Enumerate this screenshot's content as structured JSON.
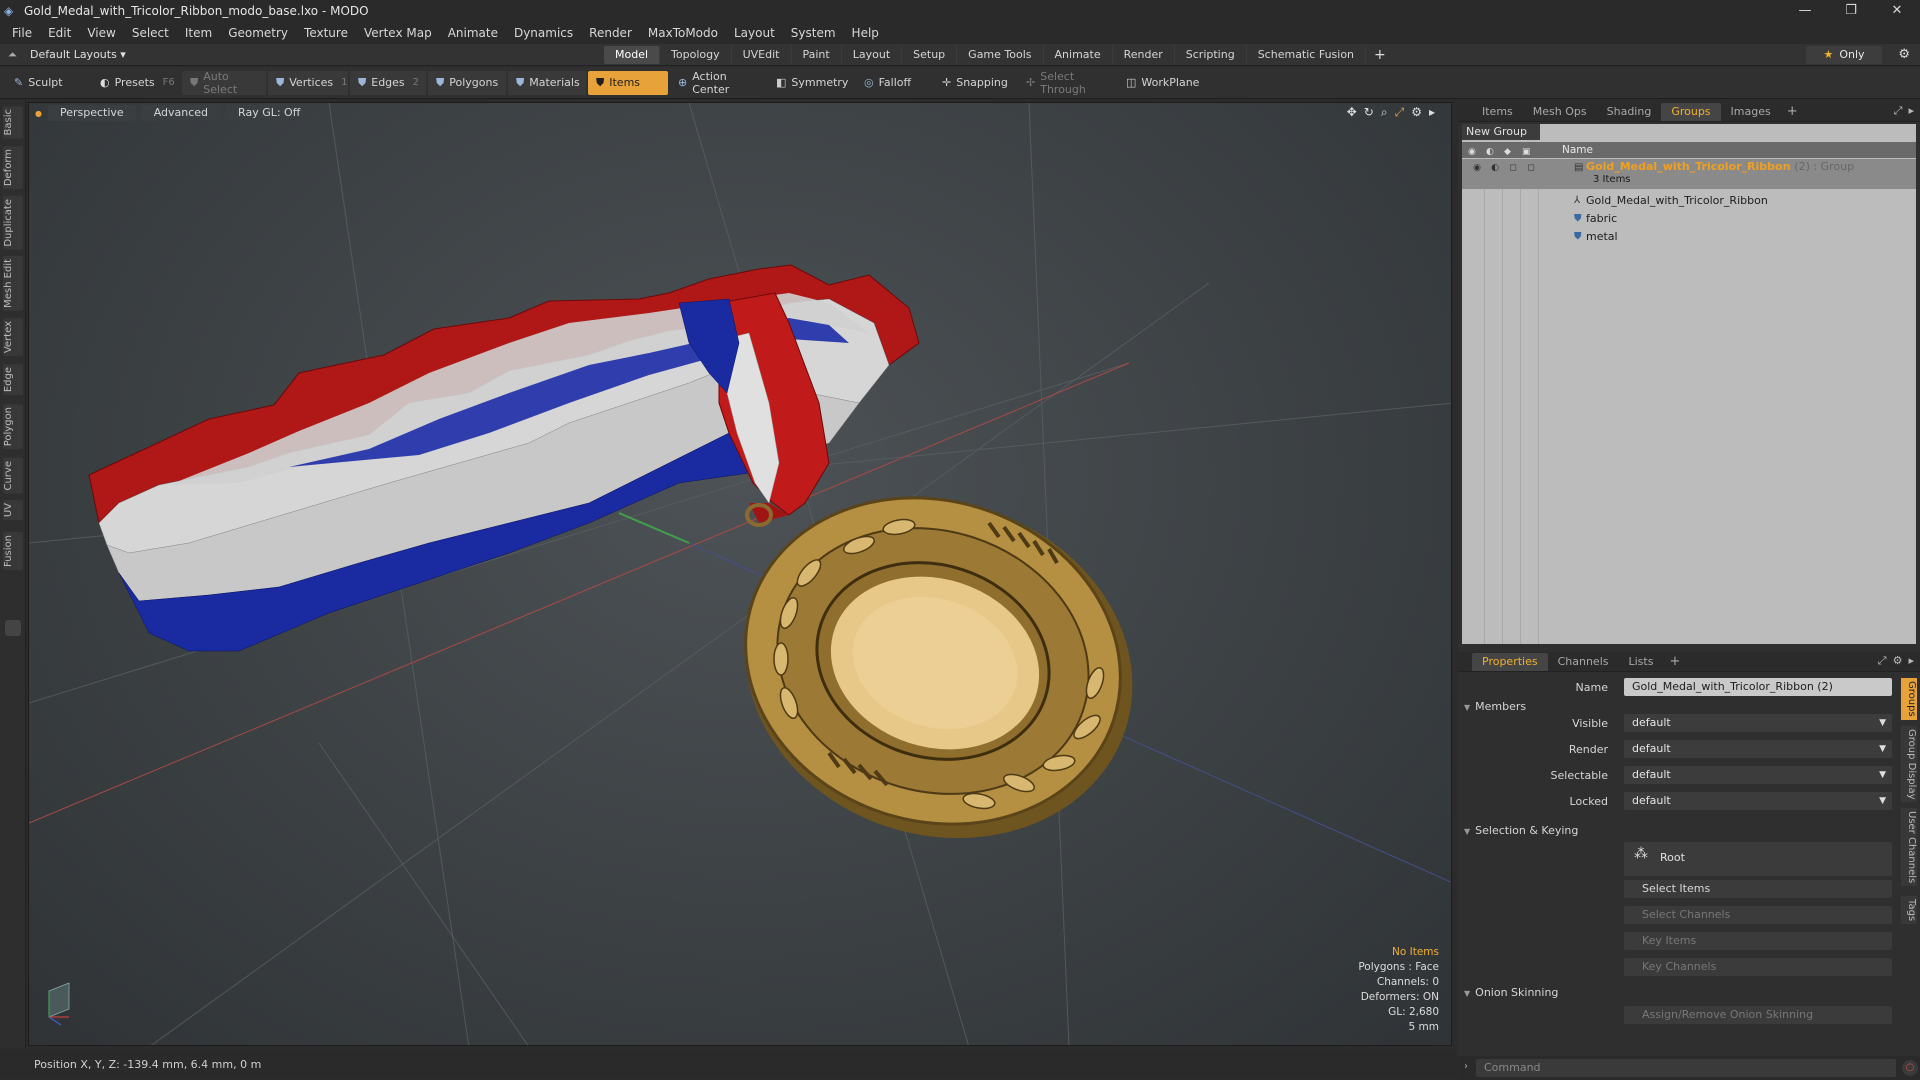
{
  "window": {
    "title": "Gold_Medal_with_Tricolor_Ribbon_modo_base.lxo - MODO",
    "minimize": "—",
    "restore": "❐",
    "close": "✕"
  },
  "menu": [
    "File",
    "Edit",
    "View",
    "Select",
    "Item",
    "Geometry",
    "Texture",
    "Vertex Map",
    "Animate",
    "Dynamics",
    "Render",
    "MaxToModo",
    "Layout",
    "System",
    "Help"
  ],
  "layoutbar": {
    "layouts_label": "Default Layouts ▾",
    "tabs": [
      "Model",
      "Topology",
      "UVEdit",
      "Paint",
      "Layout",
      "Setup",
      "Game Tools",
      "Animate",
      "Render",
      "Scripting",
      "Schematic Fusion"
    ],
    "active_tab": "Model",
    "add_tab": "+",
    "only_label": "Only"
  },
  "toolbar": {
    "sculpt": "Sculpt",
    "presets": "Presets",
    "presets_key": "F6",
    "auto_select": "Auto Select",
    "vertices": "Vertices",
    "vertices_count": "1",
    "edges": "Edges",
    "edges_count": "2",
    "polygons": "Polygons",
    "materials": "Materials",
    "items": "Items",
    "action_center": "Action Center",
    "symmetry": "Symmetry",
    "falloff": "Falloff",
    "snapping": "Snapping",
    "select_through": "Select Through",
    "workplane": "WorkPlane"
  },
  "left_tabs": [
    "Basic",
    "Deform",
    "Duplicate",
    "Mesh Edit",
    "Vertex",
    "Edge",
    "Polygon",
    "Curve",
    "UV",
    "Fusion"
  ],
  "viewport": {
    "view_mode": "Perspective",
    "shading": "Advanced",
    "raygl": "Ray GL: Off",
    "info": {
      "no_items": "No Items",
      "polygons": "Polygons : Face",
      "channels": "Channels: 0",
      "deformers": "Deformers: ON",
      "gl": "GL: 2,680",
      "scale": "5 mm"
    }
  },
  "status": {
    "position": "Position X, Y, Z:  -139.4 mm, 6.4 mm, 0 m"
  },
  "right_top_tabs": [
    "Items",
    "Mesh Ops",
    "Shading",
    "Groups",
    "Images"
  ],
  "right_top_active": "Groups",
  "groups": {
    "new_group": "New Group",
    "name_col": "Name",
    "group_name": "Gold_Medal_with_Tricolor_Ribbon",
    "group_suffix": "(2) : Group",
    "group_sub": "3 Items",
    "items": [
      "Gold_Medal_with_Tricolor_Ribbon",
      "fabric",
      "metal"
    ]
  },
  "right_bottom_tabs": [
    "Properties",
    "Channels",
    "Lists"
  ],
  "right_bottom_active": "Properties",
  "properties": {
    "name_label": "Name",
    "name_value": "Gold_Medal_with_Tricolor_Ribbon (2)",
    "members_section": "Members",
    "visible_label": "Visible",
    "visible_value": "default",
    "render_label": "Render",
    "render_value": "default",
    "selectable_label": "Selectable",
    "selectable_value": "default",
    "locked_label": "Locked",
    "locked_value": "default",
    "selection_section": "Selection & Keying",
    "root_label": "Root",
    "select_items": "Select Items",
    "select_channels": "Select Channels",
    "key_items": "Key Items",
    "key_channels": "Key Channels",
    "onion_section": "Onion Skinning",
    "assign_onion": "Assign/Remove Onion Skinning"
  },
  "side_vtabs": [
    "Groups",
    "Group Display",
    "User Channels",
    "Tags"
  ],
  "command": {
    "placeholder": "Command"
  },
  "colors": {
    "accent": "#e8a23a",
    "group_name": "#f0a020",
    "ribbon_red": "#b01818",
    "ribbon_white": "#d8d8d8",
    "ribbon_blue": "#1a2aa0",
    "gold": "#c9a050"
  }
}
